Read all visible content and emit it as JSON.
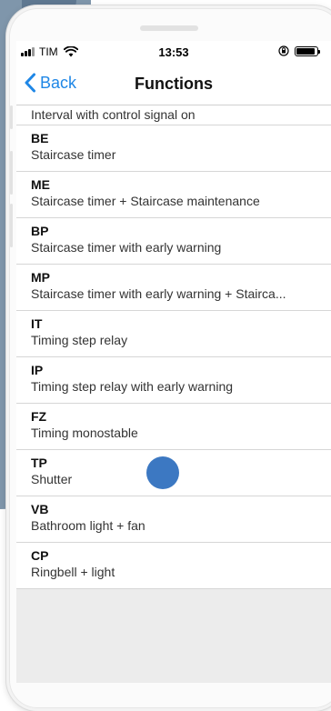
{
  "status_bar": {
    "carrier": "TIM",
    "time": "13:53"
  },
  "nav": {
    "back_label": "Back",
    "title": "Functions"
  },
  "list": {
    "first_item": {
      "desc": "Interval with control signal on"
    },
    "items": [
      {
        "code": "BE",
        "desc": "Staircase timer"
      },
      {
        "code": "ME",
        "desc": "Staircase timer + Staircase maintenance"
      },
      {
        "code": "BP",
        "desc": "Staircase timer with early warning"
      },
      {
        "code": "MP",
        "desc": "Staircase timer with early warning + Stairca..."
      },
      {
        "code": "IT",
        "desc": "Timing step relay"
      },
      {
        "code": "IP",
        "desc": "Timing step relay with early warning"
      },
      {
        "code": "FZ",
        "desc": "Timing monostable"
      },
      {
        "code": "TP",
        "desc": "Shutter"
      },
      {
        "code": "VB",
        "desc": "Bathroom light + fan"
      },
      {
        "code": "CP",
        "desc": "Ringbell + light"
      }
    ]
  },
  "colors": {
    "accent": "#1f87e6",
    "touch_indicator": "#3c78c2",
    "background_panel": "#7f96ab"
  },
  "icons": [
    "signal-icon",
    "wifi-icon",
    "orientation-lock-icon",
    "battery-icon",
    "back-chevron-icon"
  ]
}
